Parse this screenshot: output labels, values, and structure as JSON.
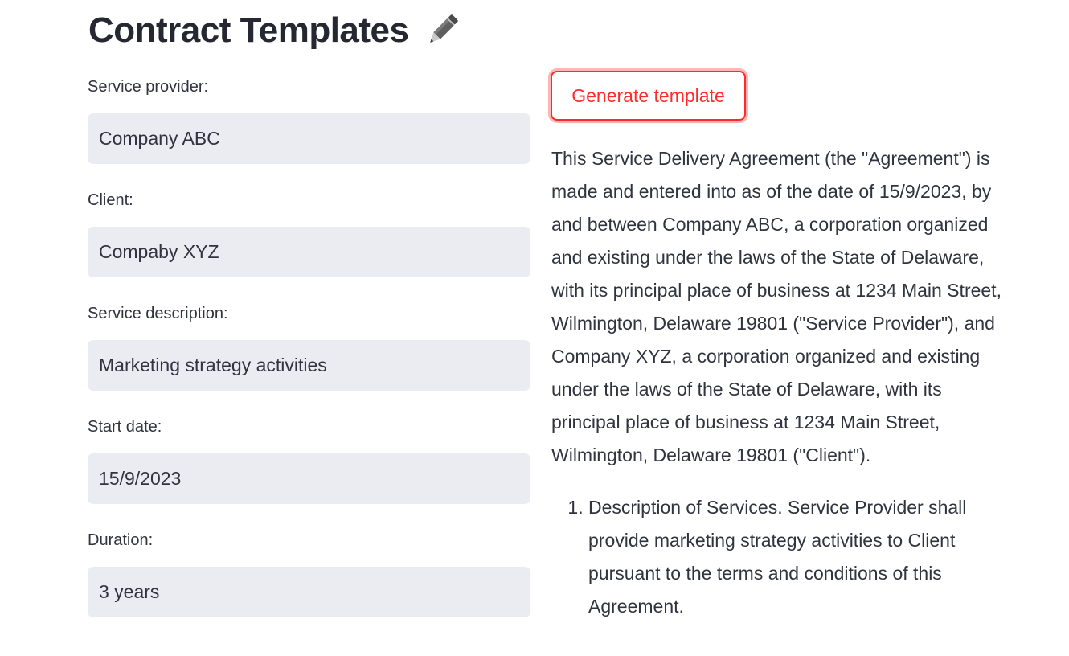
{
  "page": {
    "title": "Contract Templates",
    "title_icon": "pencil-icon"
  },
  "form": {
    "service_provider": {
      "label": "Service provider:",
      "value": "Company ABC"
    },
    "client": {
      "label": "Client:",
      "value": "Compaby XYZ"
    },
    "service_description": {
      "label": "Service description:",
      "value": "Marketing strategy activities"
    },
    "start_date": {
      "label": "Start date:",
      "value": "15/9/2023"
    },
    "duration": {
      "label": "Duration:",
      "value": "3 years"
    }
  },
  "generate_button": {
    "label": "Generate template"
  },
  "output": {
    "intro": "This Service Delivery Agreement (the \"Agreement\") is made and entered into as of the date of 15/9/2023, by and between Company ABC, a corporation organized and existing under the laws of the State of Delaware, with its principal place of business at 1234 Main Street, Wilmington, Delaware 19801 (\"Service Provider\"), and Company XYZ, a corporation organized and existing under the laws of the State of Delaware, with its principal place of business at 1234 Main Street, Wilmington, Delaware 19801 (\"Client\").",
    "items": [
      "Description of Services. Service Provider shall provide marketing strategy activities to Client pursuant to the terms and conditions of this Agreement."
    ]
  },
  "colors": {
    "accent": "#ff2b2b",
    "input_bg": "#ebecf1",
    "text": "#31333f"
  }
}
